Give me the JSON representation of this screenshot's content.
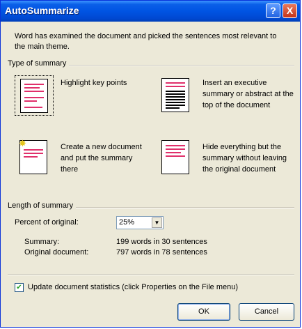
{
  "window": {
    "title": "AutoSummarize",
    "help_glyph": "?",
    "close_glyph": "X"
  },
  "intro_text": "Word has examined the document and picked the sentences most relevant to the main theme.",
  "type_group": {
    "label": "Type of summary",
    "options": [
      {
        "label": "Highlight key points",
        "selected": true
      },
      {
        "label": "Insert an executive summary or abstract at the top of the document",
        "selected": false
      },
      {
        "label": "Create a new document and put the summary there",
        "selected": false
      },
      {
        "label": "Hide everything but the summary without leaving the original document",
        "selected": false
      }
    ]
  },
  "length_group": {
    "label": "Length of summary",
    "percent_label": "Percent of original:",
    "percent_value": "25%",
    "summary_label": "Summary:",
    "summary_value": "199 words in 30 sentences",
    "original_label": "Original document:",
    "original_value": "797 words in 78 sentences"
  },
  "update_stats": {
    "checked": true,
    "check_glyph": "✔",
    "label": "Update document statistics (click Properties on the File menu)"
  },
  "buttons": {
    "ok": "OK",
    "cancel": "Cancel"
  },
  "icons": {
    "arrow": "▼",
    "star": "✸"
  },
  "colors": {
    "title_blue": "#0054e3",
    "highlight_line": "#e0306b",
    "dialog_bg": "#ece9d8"
  }
}
